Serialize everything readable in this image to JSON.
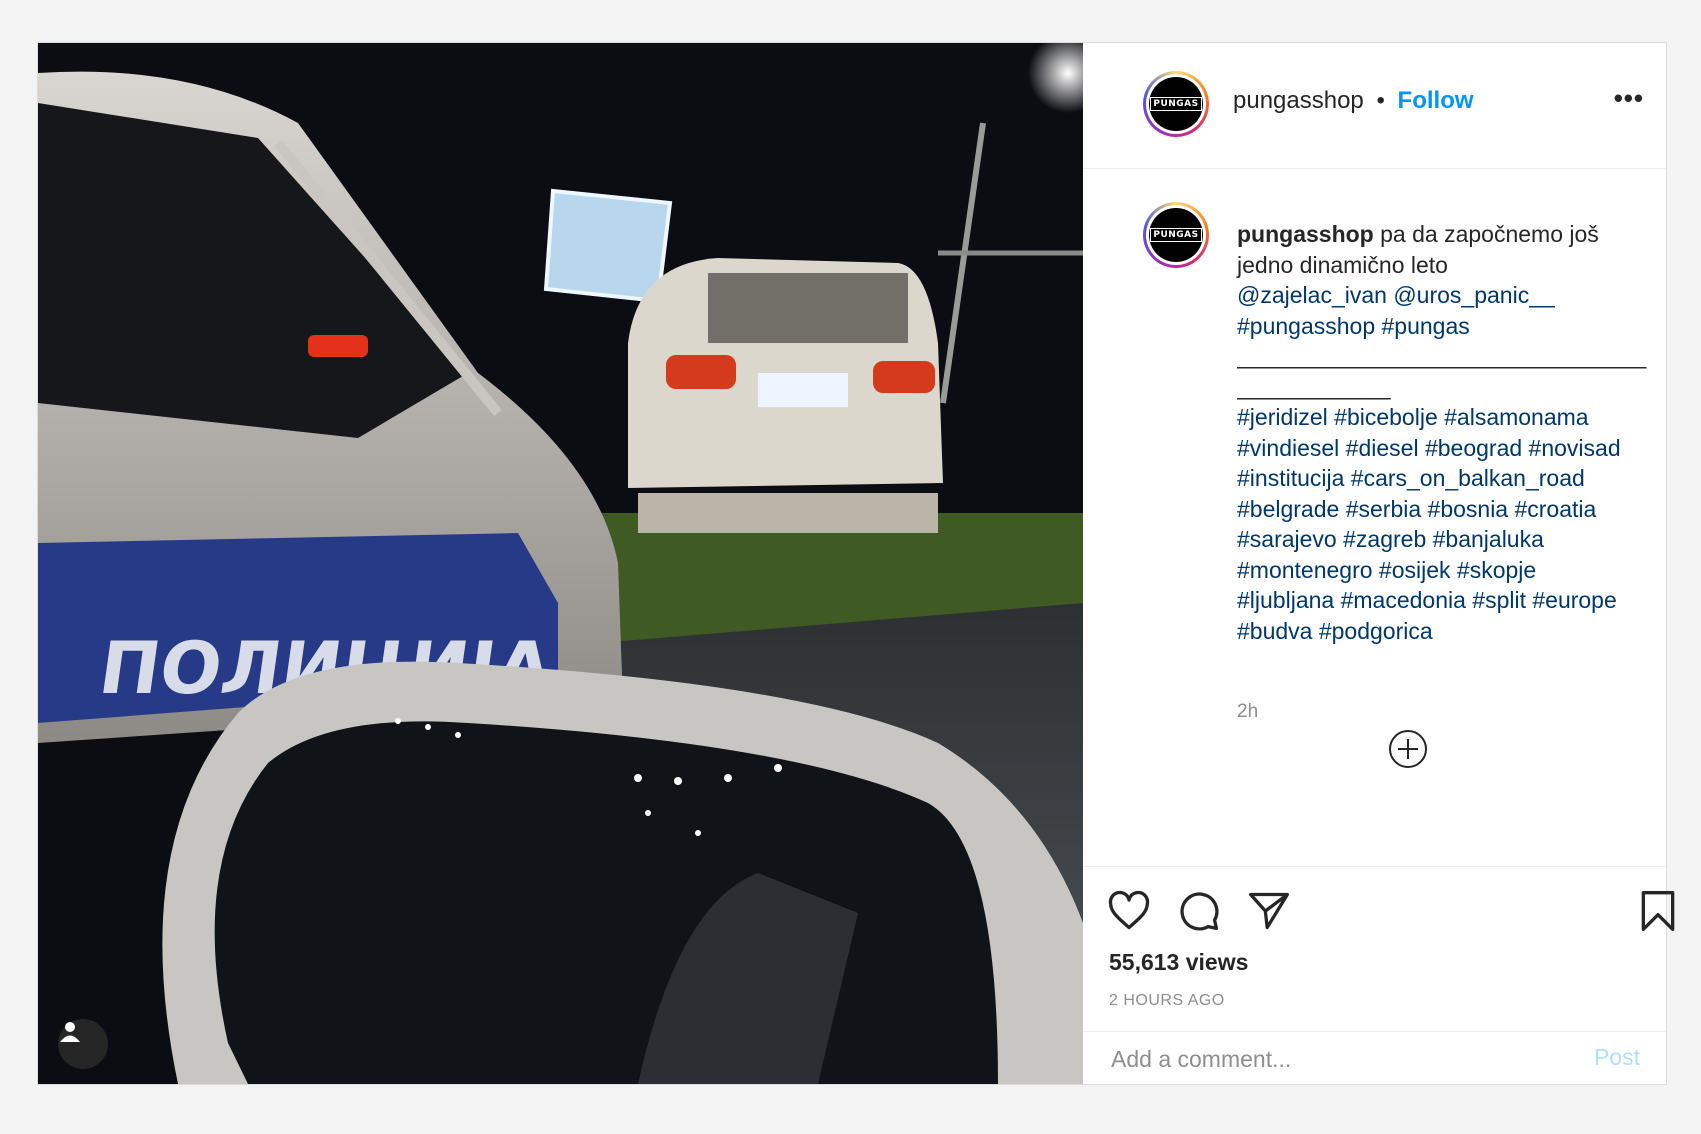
{
  "header": {
    "username": "pungasshop",
    "separator": "•",
    "follow_label": "Follow",
    "more_label": "•••",
    "avatar_logo": "PUNGAS"
  },
  "media": {
    "police_text": "ПОЛИЦИЈА",
    "tag_icon": "user-icon"
  },
  "caption": {
    "username": "pungasshop",
    "text_line1": "pa da započnemo još",
    "text_line2": "jedno dinamično leto",
    "mention1": "@zajelac_ivan",
    "mention2": "@uros_panic__",
    "tag1": "#pungasshop",
    "tag2": "#pungas",
    "rule1": "________________________________",
    "rule2": "____________",
    "hashtag_lines": [
      "#jeridizel #bicebolje #alsamonama",
      "#vindiesel #diesel #beograd #novisad",
      "#institucija #cars_on_balkan_road",
      "#belgrade #serbia #bosnia #croatia",
      "#sarajevo #zagreb #banjaluka",
      "#montenegro #osijek #skopje",
      "#ljubljana #macedonia #split #europe",
      "#budva #podgorica"
    ],
    "relative_time": "2h"
  },
  "actions": {
    "icons": [
      "heart-icon",
      "comment-icon",
      "share-icon",
      "bookmark-icon"
    ],
    "views": "55,613 views",
    "posted": "2 HOURS AGO"
  },
  "comment": {
    "placeholder": "Add a comment...",
    "post_label": "Post"
  },
  "colors": {
    "link": "#0095f6",
    "mention": "#00376b",
    "muted": "#8e8e8e",
    "post_disabled": "#b2dffc"
  }
}
